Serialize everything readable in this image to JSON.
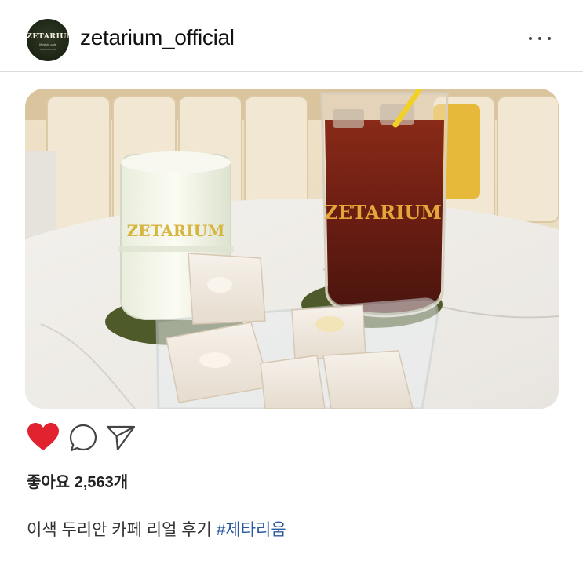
{
  "post": {
    "username": "zetarium_official",
    "avatar": {
      "brand": "ZETARIUM",
      "tagline": "lifestyle cafe",
      "subline": "DURIAN CAFE"
    },
    "more_icon": "more-horizontal-icon",
    "image": {
      "cup_left_text": "ZETARIUM",
      "cup_right_text": "ZETARIUM"
    },
    "actions": {
      "like_icon": "heart-filled-icon",
      "comment_icon": "comment-bubble-icon",
      "share_icon": "send-icon",
      "like_color": "#e0232e"
    },
    "likes_label": "좋아요 2,563개",
    "caption": {
      "text": "이색 두리안 카페 리얼 후기 ",
      "hashtag": "#제타리움",
      "hashtag_color": "#2c5aa0"
    }
  }
}
